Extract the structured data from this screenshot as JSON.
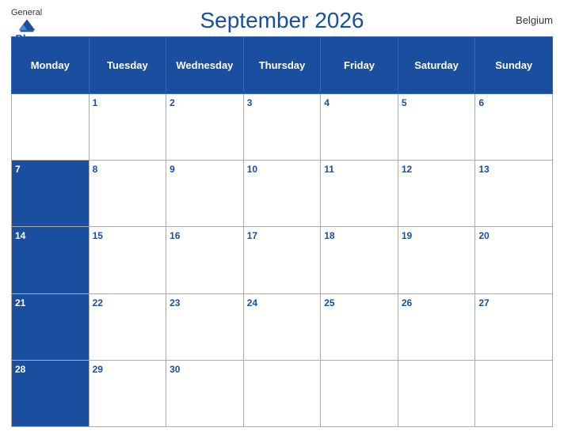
{
  "header": {
    "title": "September 2026",
    "country": "Belgium",
    "logo": {
      "general": "General",
      "blue": "Blue"
    }
  },
  "days_of_week": [
    "Monday",
    "Tuesday",
    "Wednesday",
    "Thursday",
    "Friday",
    "Saturday",
    "Sunday"
  ],
  "weeks": [
    [
      "",
      "1",
      "2",
      "3",
      "4",
      "5",
      "6"
    ],
    [
      "7",
      "8",
      "9",
      "10",
      "11",
      "12",
      "13"
    ],
    [
      "14",
      "15",
      "16",
      "17",
      "18",
      "19",
      "20"
    ],
    [
      "21",
      "22",
      "23",
      "24",
      "25",
      "26",
      "27"
    ],
    [
      "28",
      "29",
      "30",
      "",
      "",
      "",
      ""
    ]
  ]
}
